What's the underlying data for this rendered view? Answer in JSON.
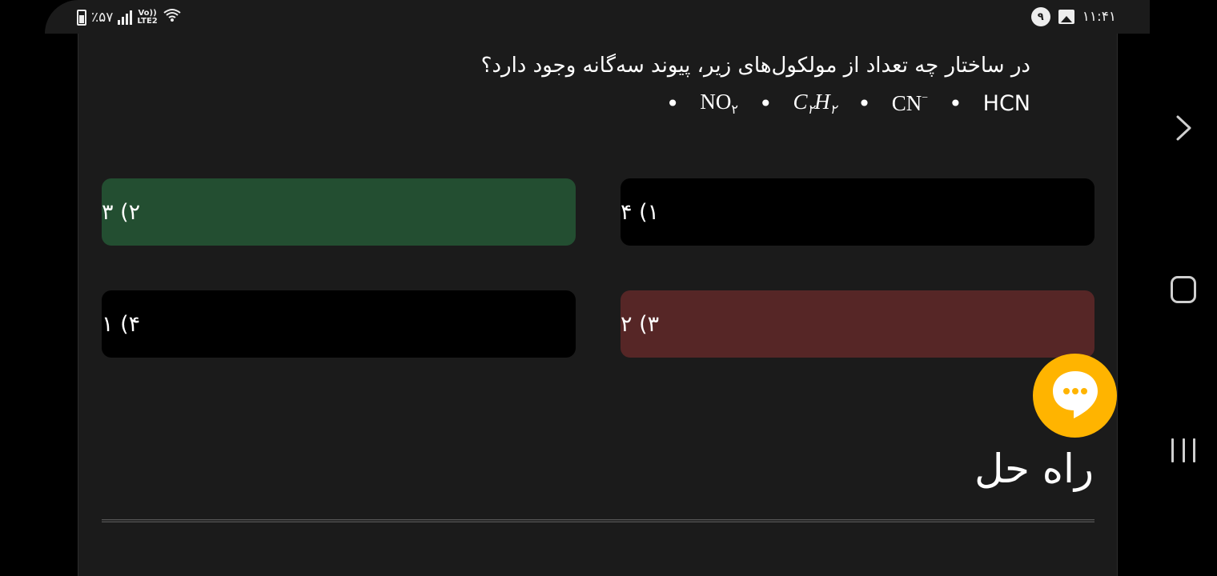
{
  "status_bar": {
    "battery": "٪۵۷",
    "network": "LTE2",
    "network_top": "Vo))",
    "notification_count": "۹",
    "time": "۱۱:۴۱"
  },
  "question": {
    "text": "در ساختار چه تعداد از مولکول‌های زیر، پیوند سه‌گانه وجود دارد؟",
    "molecules": {
      "hcn": "HCN",
      "cn_base": "CN",
      "cn_sup": "−",
      "c2h2_c": "C",
      "c2h2_sub1": "۲",
      "c2h2_h": "H",
      "c2h2_sub2": "۲",
      "no2_base": "NO",
      "no2_sub": "۲"
    }
  },
  "options": [
    {
      "label": "۱) ۴"
    },
    {
      "label": "۲) ۳"
    },
    {
      "label": "۳) ۲"
    },
    {
      "label": "۴) ۱"
    }
  ],
  "solution": {
    "title": "راه حل"
  },
  "colors": {
    "correct": "#234e31",
    "wrong": "#562626",
    "fab": "#ffb400",
    "card": "#1b1b1b"
  },
  "icons": {
    "chat_fab": "chat-bubble-icon",
    "back": "chevron-right-icon",
    "home": "home-square-icon",
    "recent": "recent-apps-icon"
  }
}
